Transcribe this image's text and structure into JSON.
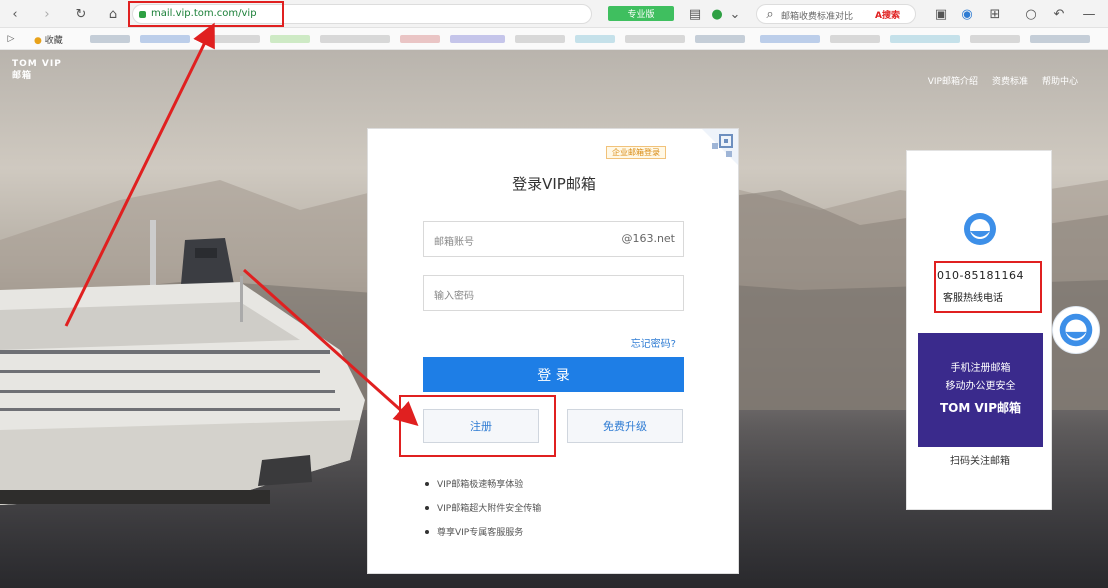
{
  "browser": {
    "url_text": "mail.vip.tom.com/vip",
    "green_pill": "专业版",
    "search_text": "邮箱收费标准对比",
    "search_badge": "A搜索",
    "bookmark_label": "收藏"
  },
  "page": {
    "brand": [
      "TOM VIP",
      "邮箱"
    ],
    "top_links": [
      "VIP邮箱介绍",
      "资费标准",
      "帮助中心"
    ]
  },
  "login": {
    "badge": "企业邮箱登录",
    "title": "登录VIP邮箱",
    "username_placeholder": "邮箱账号",
    "username_suffix": "@163.net",
    "password_placeholder": "输入密码",
    "forgot": "忘记密码?",
    "login_button": "登 录",
    "register_button": "注册",
    "upgrade_button": "免费升级",
    "benefits": [
      "VIP邮箱极速畅享体验",
      "VIP邮箱超大附件安全传输",
      "尊享VIP专属客服服务"
    ]
  },
  "side": {
    "hotline_number": "010-85181164",
    "hotline_label": "客服热线电话",
    "promo_line1": "手机注册邮箱",
    "promo_line2": "移动办公更安全",
    "promo_line3": "TOM VIP邮箱",
    "caption": "扫码关注邮箱"
  },
  "colors": {
    "primary": "#1e7ee6",
    "annotation": "#e02020",
    "promo_bg": "#3a2a8c"
  }
}
